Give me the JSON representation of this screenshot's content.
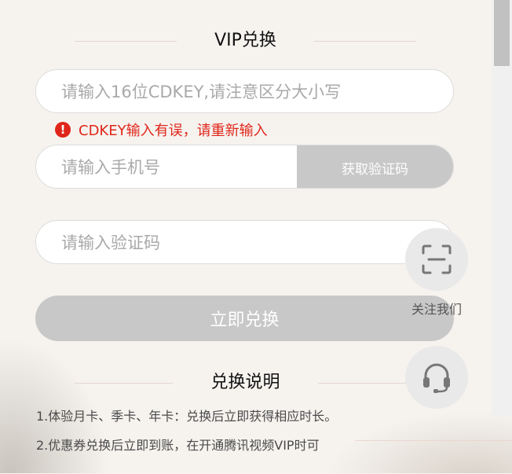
{
  "vip_section": {
    "title": "VIP兑换"
  },
  "form": {
    "cdkey_placeholder": "请输入16位CDKEY,请注意区分大小写",
    "error_message": "CDKEY输入有误，请重新输入",
    "phone_placeholder": "请输入手机号",
    "get_code_label": "获取验证码",
    "code_placeholder": "请输入验证码",
    "submit_label": "立即兑换"
  },
  "instructions": {
    "title": "兑换说明",
    "items": [
      "1.体验月卡、季卡、年卡：兑换后立即获得相应时长。",
      "2.优惠券兑换后立即到账，在开通腾讯视频VIP时可"
    ]
  },
  "side": {
    "follow_label": "关注我们"
  },
  "colors": {
    "error": "#e0261a",
    "disabled_button": "#c8c8c8",
    "background": "#f6f3ef"
  },
  "icons": [
    "scan-icon",
    "headset-icon",
    "error-icon"
  ]
}
